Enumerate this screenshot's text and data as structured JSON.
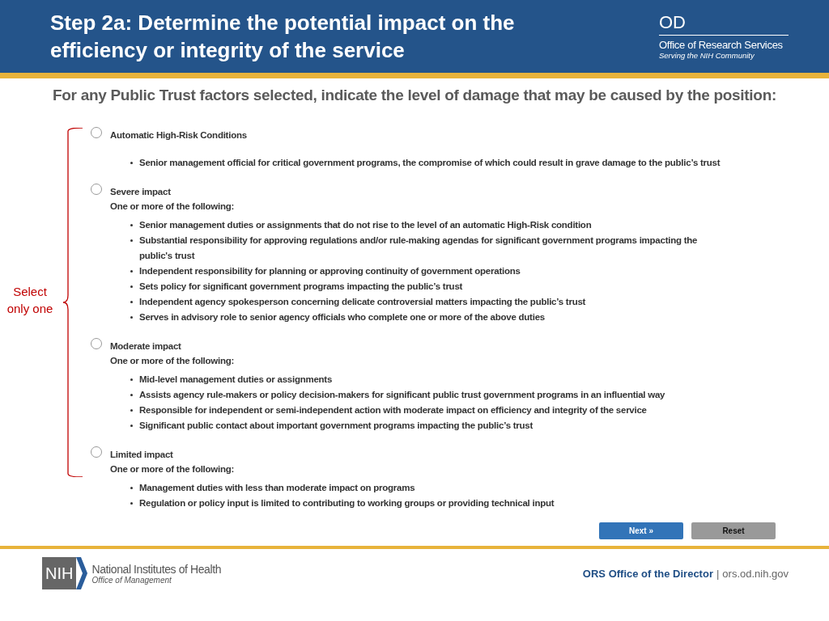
{
  "header": {
    "title": "Step 2a: Determine the potential impact on the efficiency or integrity of the service",
    "logo": {
      "mark": "OD",
      "name": "Office of Research Services",
      "tagline": "Serving the NIH Community"
    }
  },
  "instruction": "For any Public Trust factors selected, indicate the level of damage that may be caused by the position:",
  "note": "Select only one",
  "options": [
    {
      "label": "Automatic High-Risk Conditions",
      "selected": false,
      "bullets": [
        "Senior management official for critical government programs, the compromise of which could result in grave damage to the public’s trust"
      ]
    },
    {
      "label": "Severe impact",
      "selected": false,
      "subtitle": "One or more of the following:",
      "bullets": [
        "Senior management duties or assignments that do not rise to the level of an automatic High-Risk condition",
        "Substantial responsibility for approving regulations and/or rule-making agendas for significant government programs impacting the public's trust",
        "Independent responsibility for planning or approving continuity of government operations",
        "Sets policy for significant government programs impacting the public’s trust",
        "Independent agency spokesperson concerning delicate controversial matters impacting the public’s trust",
        "Serves in advisory role to senior agency officials who complete one or more of the above duties"
      ]
    },
    {
      "label": "Moderate impact",
      "selected": false,
      "subtitle": "One or more of the following:",
      "bullets": [
        "Mid-level management duties or assignments",
        "Assists agency rule-makers or policy decision-makers for significant public trust government programs in an influential way",
        "Responsible for independent or semi-independent action with moderate impact on efficiency and integrity of the service",
        "Significant public contact about important government programs impacting the public’s trust"
      ]
    },
    {
      "label": "Limited impact",
      "selected": false,
      "subtitle": "One or more of the following:",
      "bullets": [
        "Management duties with less than moderate impact on programs",
        "Regulation or policy input is limited to contributing to working groups or providing technical input"
      ]
    }
  ],
  "buttons": [
    {
      "label": "Next »",
      "kind": "primary"
    },
    {
      "label": "Reset",
      "kind": "secondary"
    }
  ],
  "footer": {
    "logo": {
      "mark": "NIH",
      "name": "National Institutes of Health",
      "sub": "Office of Management"
    },
    "org": "ORS Office of the Director",
    "separator": "|",
    "url": "ors.od.nih.gov"
  }
}
